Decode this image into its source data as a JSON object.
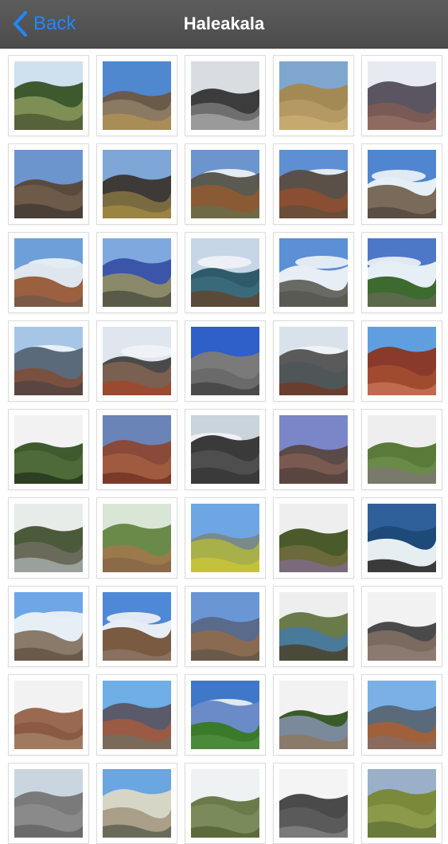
{
  "navbar": {
    "back_label": "Back",
    "title": "Haleakala",
    "accent_color": "#1e88ff",
    "back_icon": "chevron-left-icon"
  },
  "photos": [
    {
      "sky": "#cfe0ef",
      "far": "#3d5a2f",
      "near": "#7e8f55",
      "fg": "#55623a",
      "cloud": false
    },
    {
      "sky": "#4f88cf",
      "far": "#6a5a4a",
      "near": "#8a7a62",
      "fg": "#a88d57",
      "cloud": false
    },
    {
      "sky": "#d9dde2",
      "far": "#3c3c3c",
      "near": "#6e6e6e",
      "fg": "#9a9a9a",
      "cloud": false
    },
    {
      "sky": "#7fa6cf",
      "far": "#a38a55",
      "near": "#b49a62",
      "fg": "#c6a96e",
      "cloud": false
    },
    {
      "sky": "#e7ebf1",
      "far": "#5a5560",
      "near": "#7a5a55",
      "fg": "#8e6a60",
      "cloud": false
    },
    {
      "sky": "#6c95cd",
      "far": "#5a4a3e",
      "near": "#6e5a48",
      "fg": "#4a4038",
      "cloud": false
    },
    {
      "sky": "#7ea6d6",
      "far": "#3e3a38",
      "near": "#7a6a40",
      "fg": "#9a8442",
      "cloud": false
    },
    {
      "sky": "#6c95cd",
      "far": "#5a5a50",
      "near": "#8a5a35",
      "fg": "#6e6a45",
      "cloud": true
    },
    {
      "sky": "#5f8fd3",
      "far": "#5a5048",
      "near": "#8a4e32",
      "fg": "#6a4e3a",
      "cloud": true
    },
    {
      "sky": "#4f86cf",
      "far": "#e6eef6",
      "near": "#7a6a5a",
      "fg": "#5a4e44",
      "cloud": true
    },
    {
      "sky": "#6f9fd8",
      "far": "#dfe6ee",
      "near": "#9a6040",
      "fg": "#7a5a46",
      "cloud": true
    },
    {
      "sky": "#7fa9de",
      "far": "#3b55a8",
      "near": "#8a8a6a",
      "fg": "#5a5a48",
      "cloud": false
    },
    {
      "sky": "#c6d6e6",
      "far": "#2f5a6a",
      "near": "#3a6a7a",
      "fg": "#5a4a3a",
      "cloud": true
    },
    {
      "sky": "#5b8fd6",
      "far": "#e8eef5",
      "near": "#6a6a64",
      "fg": "#5a5a54",
      "cloud": true
    },
    {
      "sky": "#4d78c8",
      "far": "#e6eef6",
      "near": "#3d6a2e",
      "fg": "#5a6a4a",
      "cloud": true
    },
    {
      "sky": "#a7c6e6",
      "far": "#5a6a7a",
      "near": "#7a5040",
      "fg": "#5a4640",
      "cloud": true
    },
    {
      "sky": "#dfe6ee",
      "far": "#4a4a4a",
      "near": "#7a6050",
      "fg": "#9a4a30",
      "cloud": true
    },
    {
      "sky": "#2f5fc8",
      "far": "#7a7a7a",
      "near": "#6a6a6a",
      "fg": "#4a4a4a",
      "cloud": false
    },
    {
      "sky": "#d9e1ea",
      "far": "#5a5a5a",
      "near": "#4e5658",
      "fg": "#6a3e2e",
      "cloud": true
    },
    {
      "sky": "#5f9fe0",
      "far": "#8a3a2a",
      "near": "#a04a30",
      "fg": "#c06a50",
      "cloud": false
    },
    {
      "sky": "#f2f2f2",
      "far": "#3e5a2e",
      "near": "#4e6a38",
      "fg": "#2e3e22",
      "cloud": false
    },
    {
      "sky": "#6a84b8",
      "far": "#8a4a3a",
      "near": "#a05a40",
      "fg": "#7a3a2a",
      "cloud": false
    },
    {
      "sky": "#c9d4dd",
      "far": "#3a3a3a",
      "near": "#4e4e4e",
      "fg": "#3a3a3a",
      "cloud": true
    },
    {
      "sky": "#7b86c8",
      "far": "#5a4a48",
      "near": "#7a5a50",
      "fg": "#5a4640",
      "cloud": false
    },
    {
      "sky": "#eeeeee",
      "far": "#5a7a3a",
      "near": "#6a8a4a",
      "fg": "#7a7a6a",
      "cloud": false
    },
    {
      "sky": "#e8ece8",
      "far": "#4a5a3a",
      "near": "#6a6a5a",
      "fg": "#9aa09a",
      "cloud": false
    },
    {
      "sky": "#d9e6d6",
      "far": "#6a8a4a",
      "near": "#9a7a4a",
      "fg": "#8a6a48",
      "cloud": false
    },
    {
      "sky": "#6ea6e4",
      "far": "#7a8a8a",
      "near": "#a8b04a",
      "fg": "#c4c23a",
      "cloud": false
    },
    {
      "sky": "#eeeeee",
      "far": "#4a5a2a",
      "near": "#6a6a3a",
      "fg": "#7a6a7a",
      "cloud": false
    },
    {
      "sky": "#2f5f98",
      "far": "#1e4a7a",
      "near": "#e6eef2",
      "fg": "#3a3a3a",
      "cloud": false
    },
    {
      "sky": "#6fa6e6",
      "far": "#e6eef6",
      "near": "#8a7a6a",
      "fg": "#6a5a4a",
      "cloud": true
    },
    {
      "sky": "#4f88d6",
      "far": "#e8eef6",
      "near": "#7a5a40",
      "fg": "#8a7060",
      "cloud": true
    },
    {
      "sky": "#6a96d6",
      "far": "#5a6a8a",
      "near": "#8a6a50",
      "fg": "#6a5a4a",
      "cloud": false
    },
    {
      "sky": "#eeeeee",
      "far": "#6a7a4a",
      "near": "#4a7a9a",
      "fg": "#4a4a3a",
      "cloud": false
    },
    {
      "sky": "#f2f2f2",
      "far": "#4a4a4a",
      "near": "#7a6a60",
      "fg": "#8a7a70",
      "cloud": false
    },
    {
      "sky": "#f2f2f2",
      "far": "#9a6a50",
      "near": "#8a5a44",
      "fg": "#a07a60",
      "cloud": false
    },
    {
      "sky": "#6faee6",
      "far": "#5a5a6a",
      "near": "#9a5a44",
      "fg": "#7a6a5a",
      "cloud": false
    },
    {
      "sky": "#3f78c8",
      "far": "#6a8ac8",
      "near": "#3a7a2a",
      "fg": "#4a8a3a",
      "cloud": true
    },
    {
      "sky": "#f2f2f2",
      "far": "#3a5a2a",
      "near": "#7a8a9a",
      "fg": "#8a7a6a",
      "cloud": false
    },
    {
      "sky": "#7ab0e6",
      "far": "#5a6a7a",
      "near": "#a0603a",
      "fg": "#8a6a5a",
      "cloud": false
    },
    {
      "sky": "#c9d6e0",
      "far": "#7a7a7a",
      "near": "#8a8a8a",
      "fg": "#6a6a6a",
      "cloud": false
    },
    {
      "sky": "#6aa6e0",
      "far": "#d6d6c6",
      "near": "#aaa08a",
      "fg": "#6a6a5a",
      "cloud": false
    },
    {
      "sky": "#eef2f2",
      "far": "#6a7a4a",
      "near": "#7a8a5a",
      "fg": "#5a6a3a",
      "cloud": false
    },
    {
      "sky": "#f4f4f4",
      "far": "#4a4a4a",
      "near": "#5a5a5a",
      "fg": "#7a7a7a",
      "cloud": false
    },
    {
      "sky": "#9ab0c8",
      "far": "#7a8a3a",
      "near": "#8a9a4a",
      "fg": "#6a7a3a",
      "cloud": false
    }
  ]
}
